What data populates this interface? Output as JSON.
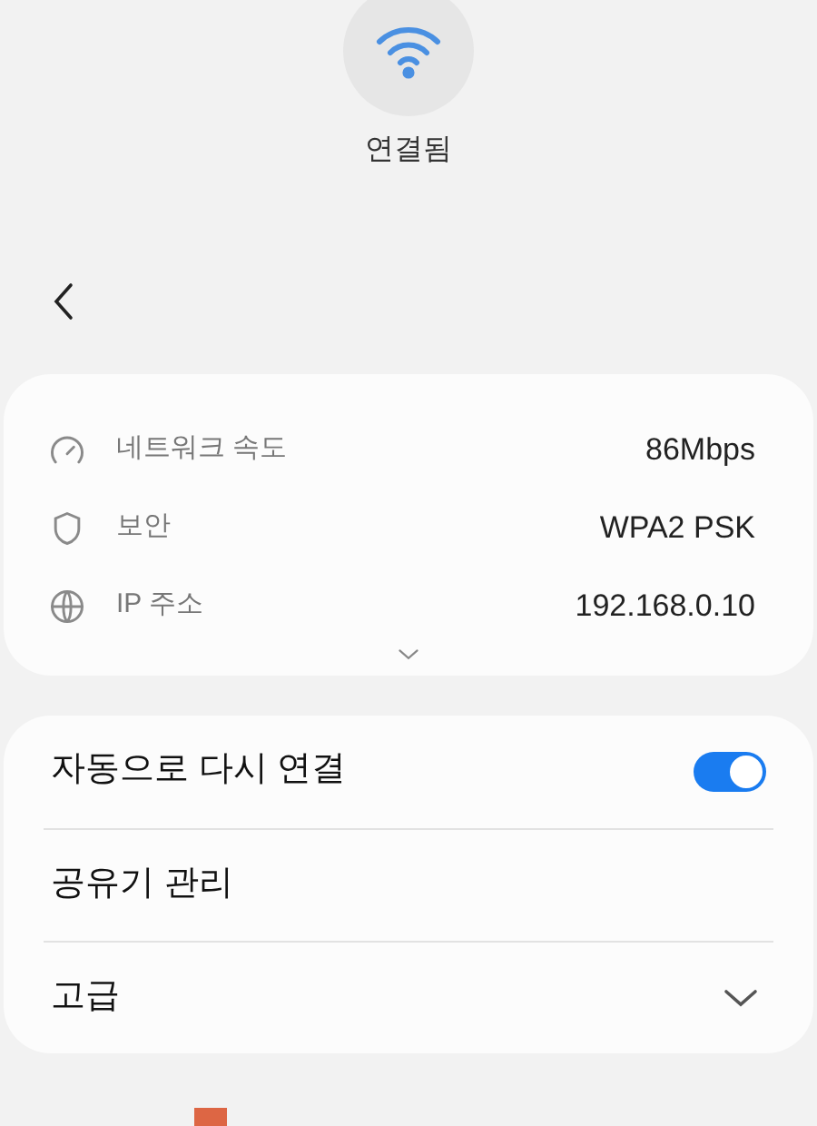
{
  "status": {
    "label": "연결됨"
  },
  "info": [
    {
      "kind": "speed",
      "label": "네트워크 속도",
      "value": "86Mbps"
    },
    {
      "kind": "security",
      "label": "보안",
      "value": "WPA2 PSK"
    },
    {
      "kind": "ip",
      "label": "IP 주소",
      "value": "192.168.0.10"
    }
  ],
  "settings": [
    {
      "kind": "toggle",
      "label": "자동으로 다시 연결",
      "on": true
    },
    {
      "kind": "link",
      "label": "공유기 관리"
    },
    {
      "kind": "expand",
      "label": "고급",
      "expanded": false
    }
  ]
}
